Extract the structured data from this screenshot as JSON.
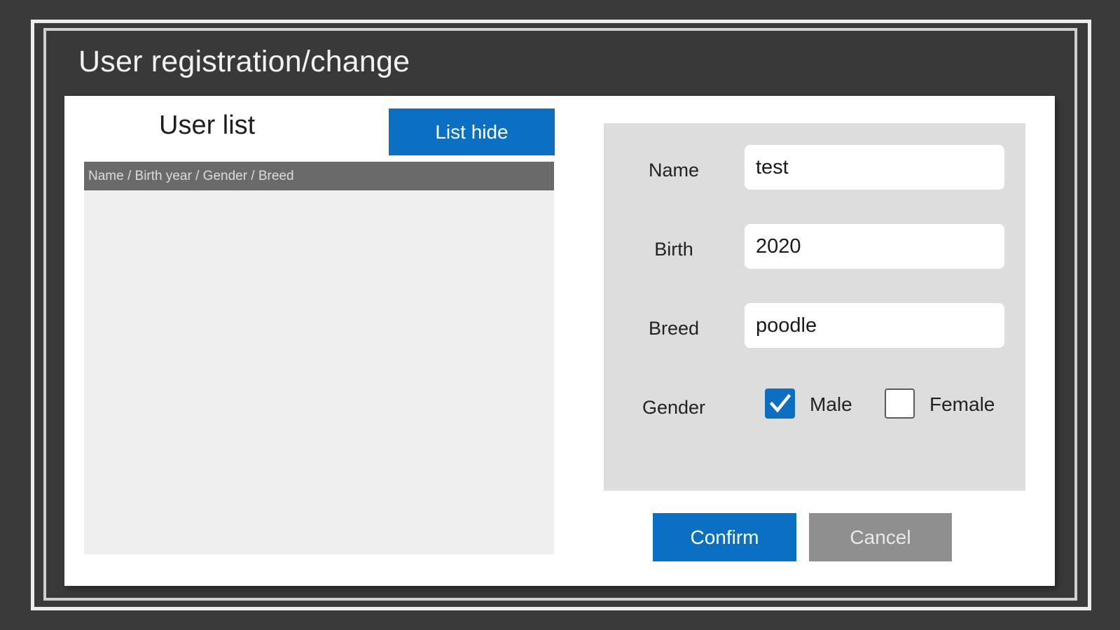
{
  "window": {
    "title": "User registration/change"
  },
  "user_list": {
    "title": "User list",
    "hide_button_label": "List hide",
    "header": "Name / Birth year / Gender / Breed",
    "rows": []
  },
  "form": {
    "name": {
      "label": "Name",
      "value": "test"
    },
    "birth": {
      "label": "Birth",
      "value": "2020"
    },
    "breed": {
      "label": "Breed",
      "value": "poodle"
    },
    "gender": {
      "label": "Gender",
      "options": [
        {
          "label": "Male",
          "checked": true
        },
        {
          "label": "Female",
          "checked": false
        }
      ]
    }
  },
  "actions": {
    "confirm_label": "Confirm",
    "cancel_label": "Cancel"
  },
  "colors": {
    "accent": "#0b70c2",
    "cancel": "#8f8f8f",
    "background": "#3a3a3a"
  },
  "icons": {
    "checkbox_checked": "check-icon"
  }
}
